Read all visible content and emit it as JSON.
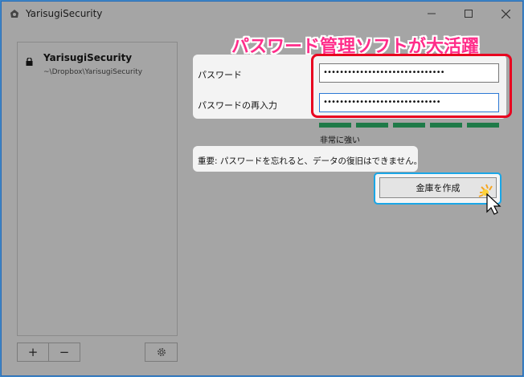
{
  "window": {
    "title": "YarisugiSecurity",
    "controls": {
      "minimize": "—",
      "maximize": "☐",
      "close": "✕"
    }
  },
  "sidebar": {
    "vaults": [
      {
        "name": "YarisugiSecurity",
        "path": "~\\Dropbox\\YarisugiSecurity",
        "icon": "lock-icon"
      }
    ],
    "add_label": "+",
    "remove_label": "−",
    "settings_icon": "gear-icon"
  },
  "annotation": {
    "banner": "パスワード管理ソフトが大活躍",
    "color": "#ff2d8a",
    "highlight_color": "#e8001f"
  },
  "form": {
    "password_label": "パスワード",
    "password_value": "••••••••••••••••••••••••••••••",
    "confirm_label": "パスワードの再入力",
    "confirm_value": "•••••••••••••••••••••••••••••"
  },
  "strength": {
    "label": "非常に強い",
    "segments_filled": 5,
    "segments_total": 5,
    "color": "#1f7a48"
  },
  "warning": "重要: パスワードを忘れると、データの復旧はできません。",
  "create_button": "金庫を作成"
}
